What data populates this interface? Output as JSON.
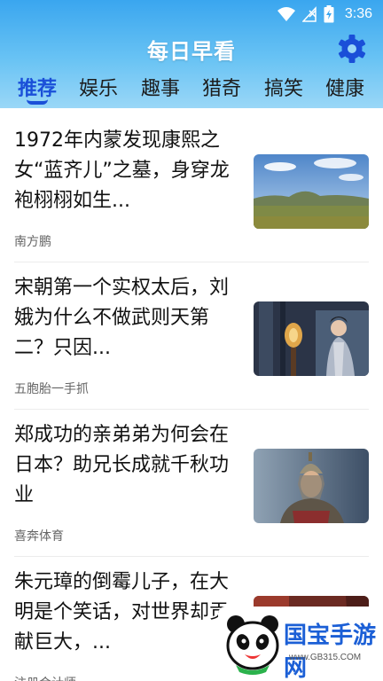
{
  "status_bar": {
    "time": "3:36",
    "icons": [
      "wifi-icon",
      "no-signal-icon",
      "battery-charging-icon"
    ]
  },
  "app_bar": {
    "title": "每日早看",
    "settings_icon": "gear-icon"
  },
  "tabs": [
    {
      "label": "推荐",
      "active": true
    },
    {
      "label": "娱乐",
      "active": false
    },
    {
      "label": "趣事",
      "active": false
    },
    {
      "label": "猎奇",
      "active": false
    },
    {
      "label": "搞笑",
      "active": false
    },
    {
      "label": "健康",
      "active": false
    }
  ],
  "colors": {
    "accent": "#1a4fd8",
    "header_top": "#3aa6ef",
    "header_bottom": "#9ad7f7"
  },
  "feed": [
    {
      "title": "1972年内蒙发现康熙之女“蓝齐儿”之墓，身穿龙袍栩栩如生...",
      "source": "南方鹏"
    },
    {
      "title": "宋朝第一个实权太后，刘娥为什么不做武则天第二？只因...",
      "source": "五胞胎一手抓"
    },
    {
      "title": "郑成功的亲弟弟为何会在日本？助兄长成就千秋功业",
      "source": "喜奔体育"
    },
    {
      "title": "朱元璋的倒霉儿子，在大明是个笑话，对世界却贡献巨大，...",
      "source": "注册会计师"
    }
  ],
  "watermark": {
    "text": "国宝手游网",
    "url": "www.GB315.COM"
  }
}
